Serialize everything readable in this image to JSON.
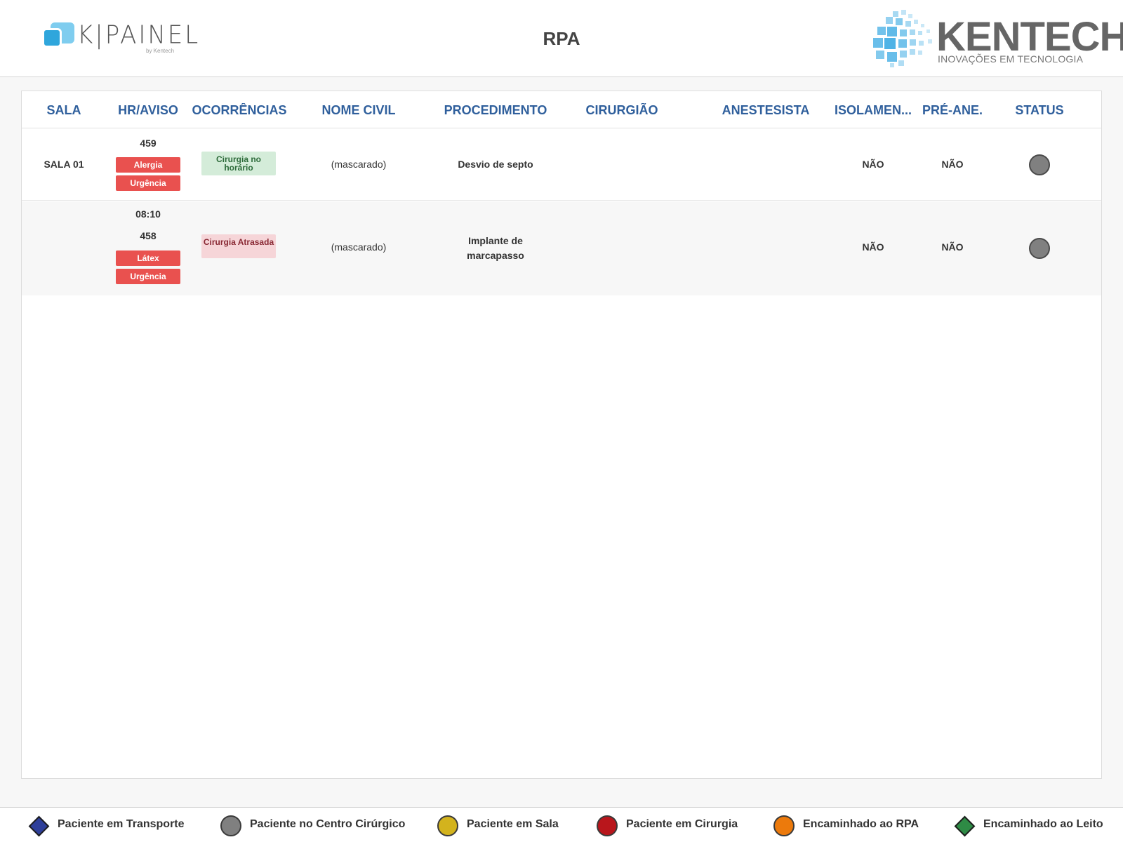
{
  "header": {
    "brand_left": "K|PAINEL",
    "brand_left_by": "by Kentech",
    "title": "RPA",
    "brand_right": "KENTECH",
    "brand_right_sub": "INOVAÇÕES EM TECNOLOGIA"
  },
  "table": {
    "columns": [
      "SALA",
      "HR/AVISO",
      "OCORRÊNCIAS",
      "NOME CIVIL",
      "PROCEDIMENTO",
      "CIRURGIÃO",
      "ANESTESISTA",
      "ISOLAMEN...",
      "PRÉ-ANE.",
      "STATUS"
    ],
    "rows": [
      {
        "sala": "SALA 01",
        "hora": "",
        "aviso": "459",
        "tags": [
          "Alergia",
          "Urgência"
        ],
        "ocorrencia": "Cirurgia no horário",
        "ocorrencia_status": "ok",
        "nome_civil": "(mascarado)",
        "procedimento": "Desvio de septo",
        "cirurgiao": "",
        "anestesista": "",
        "isolamento": "NÃO",
        "pre_ane": "NÃO",
        "status_color": "#808080"
      },
      {
        "sala": "",
        "hora": "08:10",
        "aviso": "458",
        "tags": [
          "Látex",
          "Urgência"
        ],
        "ocorrencia": "Cirurgia Atrasada",
        "ocorrencia_status": "late",
        "nome_civil": "(mascarado)",
        "procedimento": "Implante de marcapasso",
        "cirurgiao": "",
        "anestesista": "",
        "isolamento": "NÃO",
        "pre_ane": "NÃO",
        "status_color": "#808080"
      }
    ]
  },
  "legend": [
    {
      "label": "Paciente em Transporte",
      "shape": "diamond",
      "color": "#2e3f9a"
    },
    {
      "label": "Paciente no Centro Cirúrgico",
      "shape": "circle",
      "color": "#808080"
    },
    {
      "label": "Paciente em Sala",
      "shape": "circle",
      "color": "#d3b31d"
    },
    {
      "label": "Paciente em Cirurgia",
      "shape": "circle",
      "color": "#b9161c"
    },
    {
      "label": "Encaminhado ao RPA",
      "shape": "circle",
      "color": "#ec7a0c"
    },
    {
      "label": "Encaminhado ao Leito",
      "shape": "diamond",
      "color": "#2e8b45"
    }
  ],
  "colors": {
    "header_text": "#2f5f9c",
    "tag_red": "#e9514f",
    "occ_ok_bg": "#d4ecd9",
    "occ_late_bg": "#f6d5d8"
  }
}
